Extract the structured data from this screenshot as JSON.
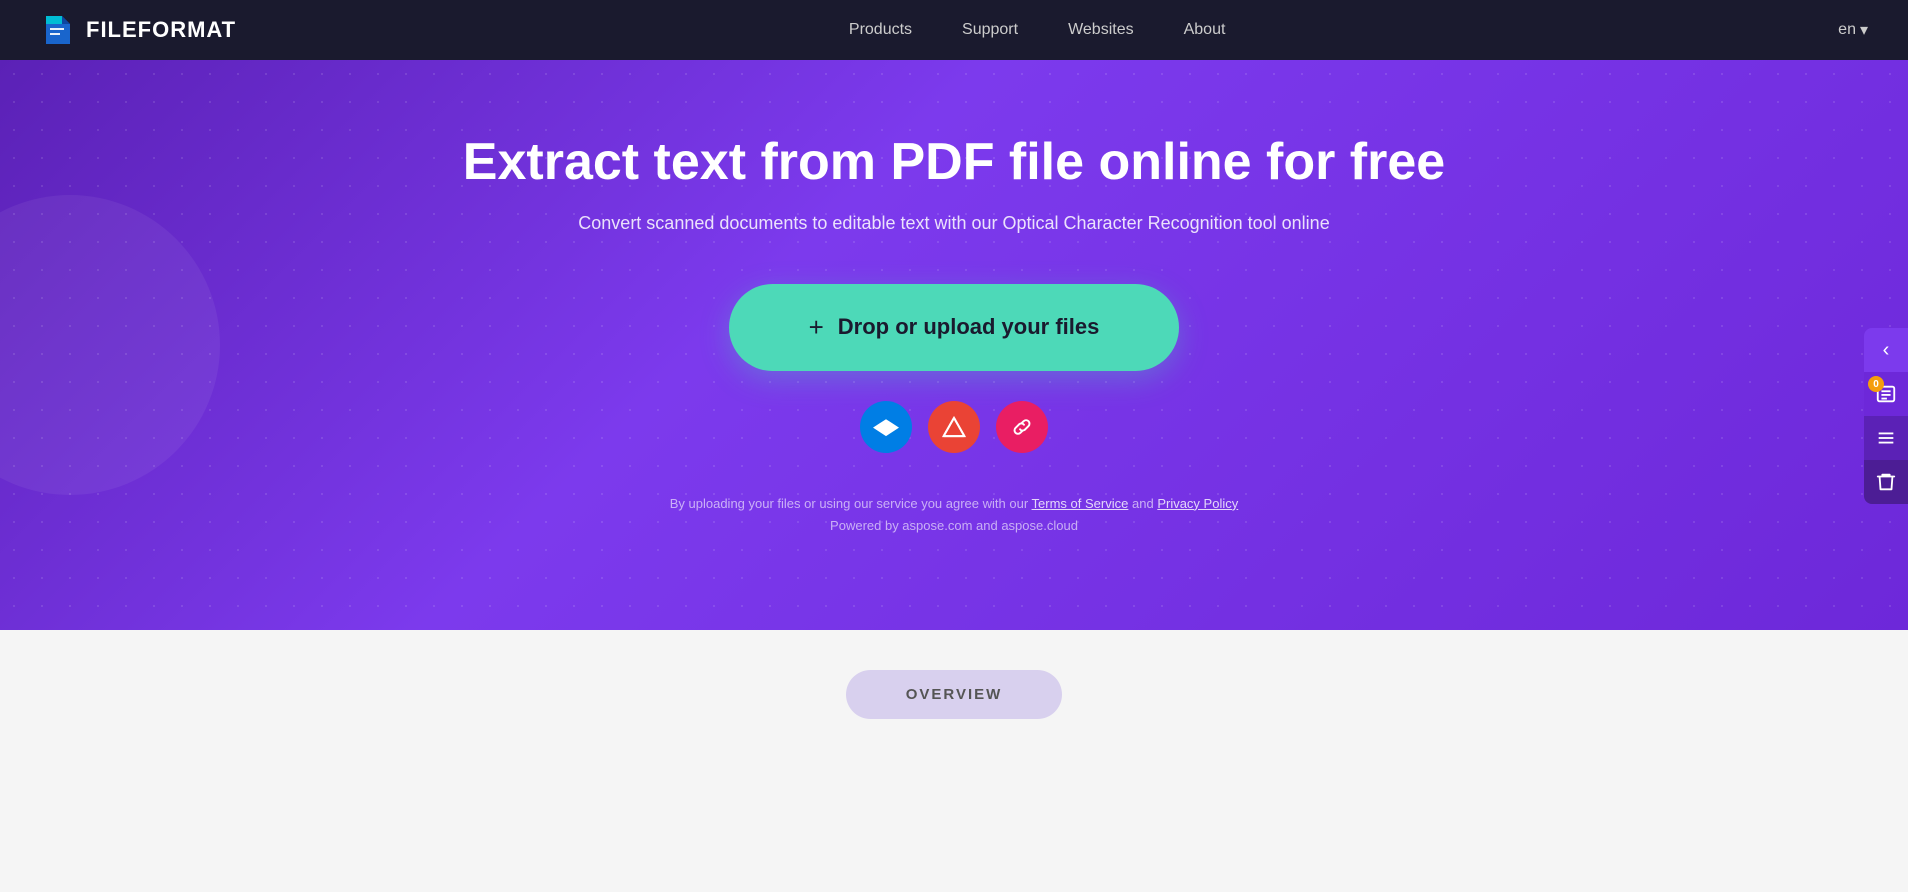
{
  "navbar": {
    "logo_text": "FILEFORMAT",
    "links": [
      {
        "id": "products",
        "label": "Products"
      },
      {
        "id": "support",
        "label": "Support"
      },
      {
        "id": "websites",
        "label": "Websites"
      },
      {
        "id": "about",
        "label": "About"
      }
    ],
    "lang": "en"
  },
  "hero": {
    "title": "Extract text from PDF file online for free",
    "subtitle": "Convert scanned documents to editable text with our Optical Character Recognition tool online",
    "upload_button": "Drop or upload your files",
    "plus_symbol": "+",
    "footer_text_1": "By uploading your files or using our service you agree with our",
    "terms_link": "Terms of Service",
    "and": "and",
    "privacy_link": "Privacy Policy",
    "powered_text": "Powered by aspose.com and aspose.cloud"
  },
  "cloud_services": [
    {
      "id": "dropbox",
      "label": "Dropbox",
      "symbol": "◈"
    },
    {
      "id": "google-drive",
      "label": "Google Drive",
      "symbol": "▲"
    },
    {
      "id": "link",
      "label": "Link",
      "symbol": "🔗"
    }
  ],
  "overview": {
    "button_label": "OVERVIEW"
  },
  "sidebar": {
    "collapse_label": "‹",
    "badge_count": "0",
    "checklist_label": "✓",
    "lines_label": "≡",
    "trash_label": "🗑"
  }
}
